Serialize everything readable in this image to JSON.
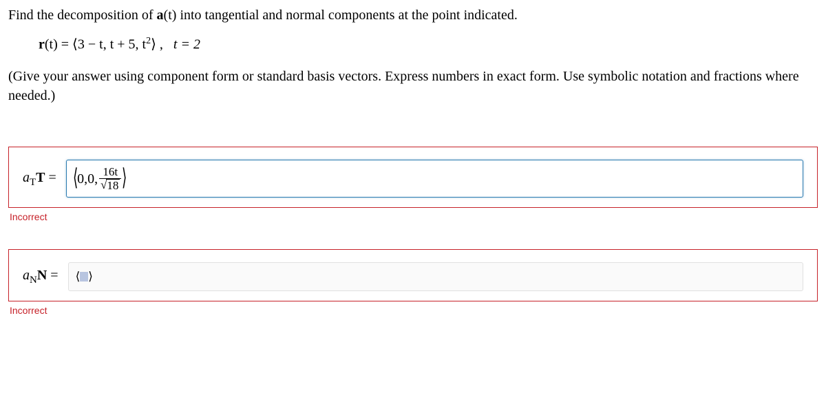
{
  "prompt": {
    "line1_pre": "Find the decomposition of ",
    "line1_bold": "a",
    "line1_arg": "(t)",
    "line1_post": " into tangential and normal components at the point indicated."
  },
  "equation": {
    "r_label": "r",
    "r_arg": "(t) = ",
    "langle": "⟨",
    "body": "3 − t, t + 5, t",
    "exp": "2",
    "rangle": "⟩",
    "comma": " ,",
    "t_eq": "t = 2"
  },
  "instruction": "(Give your answer using component form or standard basis vectors. Express numbers in exact form. Use symbolic notation and fractions where needed.)",
  "answers": {
    "aT": {
      "label_a": "a",
      "label_sub": "T",
      "label_vec": "T",
      "eq": " = ",
      "value_prefix": "0,0,",
      "frac_num": "16t",
      "frac_den_radicand": "18"
    },
    "aN": {
      "label_a": "a",
      "label_sub": "N",
      "label_vec": "N",
      "eq": " = "
    }
  },
  "feedback": {
    "incorrect1": "Incorrect",
    "incorrect2": "Incorrect"
  }
}
